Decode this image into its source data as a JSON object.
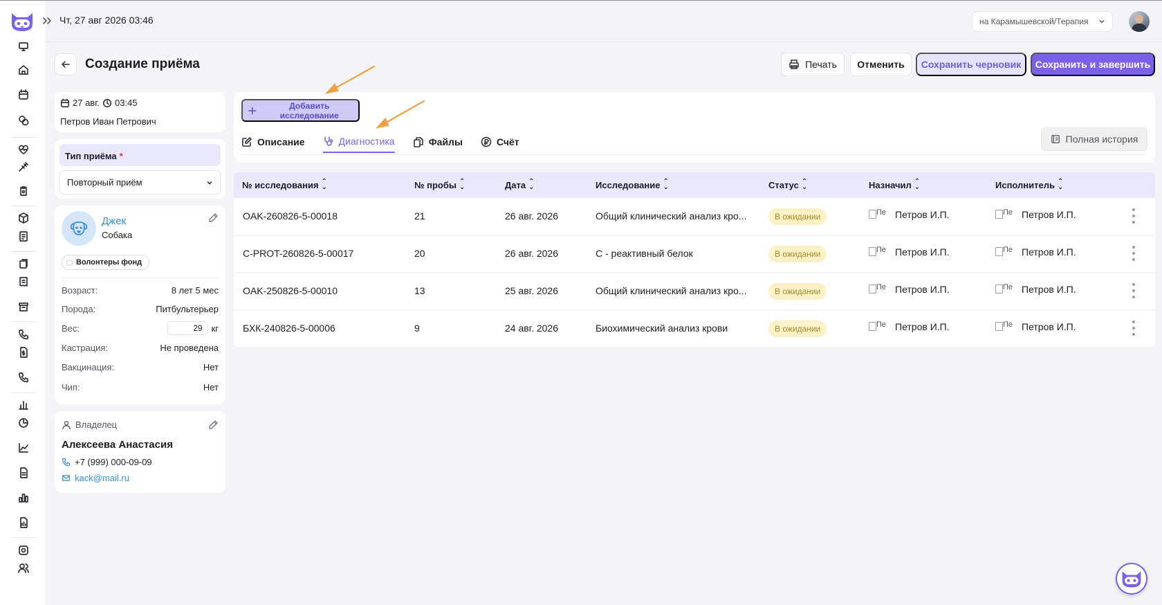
{
  "header": {
    "datetime": "Чт,  27 авг 2026 03:46",
    "branch": "на Карамышевской/Терапия"
  },
  "page": {
    "title": "Создание приёма"
  },
  "actions": {
    "print": "Печать",
    "cancel": "Отменить",
    "save_draft": "Сохранить черновик",
    "save_finish": "Сохранить и завершить"
  },
  "visit": {
    "date": "27 авг.",
    "time": "03:45",
    "doctor": "Петров Иван Петрович"
  },
  "visit_type": {
    "label": "Тип приёма",
    "required_mark": "*",
    "value": "Повторный приём"
  },
  "pet": {
    "name": "Джек",
    "species": "Собака",
    "tag": "Волонтеры фонд",
    "fields": [
      {
        "key": "Возраст:",
        "value": "8 лет 5 мес"
      },
      {
        "key": "Порода:",
        "value": "Питбультерьер"
      },
      {
        "key": "Вес:",
        "value": "29",
        "unit": "кг"
      },
      {
        "key": "Кастрация:",
        "value": "Не проведена"
      },
      {
        "key": "Вакцинация:",
        "value": "Нет"
      },
      {
        "key": "Чип:",
        "value": "Нет"
      }
    ]
  },
  "owner": {
    "heading": "Владелец",
    "name": "Алексеева Анастасия",
    "phone": "+7 (999) 000-09-09",
    "email": "kack@mail.ru"
  },
  "main": {
    "add_study": "Добавить исследование",
    "tabs": [
      {
        "label": "Описание",
        "icon": "edit-icon"
      },
      {
        "label": "Диагностика",
        "icon": "stethoscope-icon",
        "active": true
      },
      {
        "label": "Файлы",
        "icon": "files-icon"
      },
      {
        "label": "Счёт",
        "icon": "ruble-icon"
      }
    ],
    "history": "Полная история"
  },
  "table": {
    "columns": [
      "№ исследования",
      "№ пробы",
      "Дата",
      "Исследование",
      "Статус",
      "Назначил",
      "Исполнитель"
    ],
    "rows": [
      {
        "id": "OAK-260826-5-00018",
        "sample": "21",
        "date": "26 авг. 2026",
        "study": "Общий клинический анализ кро...",
        "status": "В ожидании",
        "assigned_img": "Пе",
        "assigned": "Петров И.П.",
        "performer_img": "Пе",
        "performer": "Петров И.П."
      },
      {
        "id": "C-PROT-260826-5-00017",
        "sample": "20",
        "date": "26 авг. 2026",
        "study": "С - реактивный белок",
        "status": "В ожидании",
        "assigned_img": "Пе",
        "assigned": "Петров И.П.",
        "performer_img": "Пе",
        "performer": "Петров И.П."
      },
      {
        "id": "OAK-250826-5-00010",
        "sample": "13",
        "date": "25 авг. 2026",
        "study": "Общий клинический анализ кро...",
        "status": "В ожидании",
        "assigned_img": "Пе",
        "assigned": "Петров И.П.",
        "performer_img": "Пе",
        "performer": "Петров И.П."
      },
      {
        "id": "БХК-240826-5-00006",
        "sample": "9",
        "date": "24 авг. 2026",
        "study": "Биохимический анализ крови",
        "status": "В ожидании",
        "assigned_img": "Пе",
        "assigned": "Петров И.П.",
        "performer_img": "Пе",
        "performer": "Петров И.П."
      }
    ]
  },
  "colors": {
    "accent": "#7b61e9",
    "link": "#3a8edc",
    "status_bg": "#fbf1c7",
    "annotation_arrow": "#f0a040"
  }
}
